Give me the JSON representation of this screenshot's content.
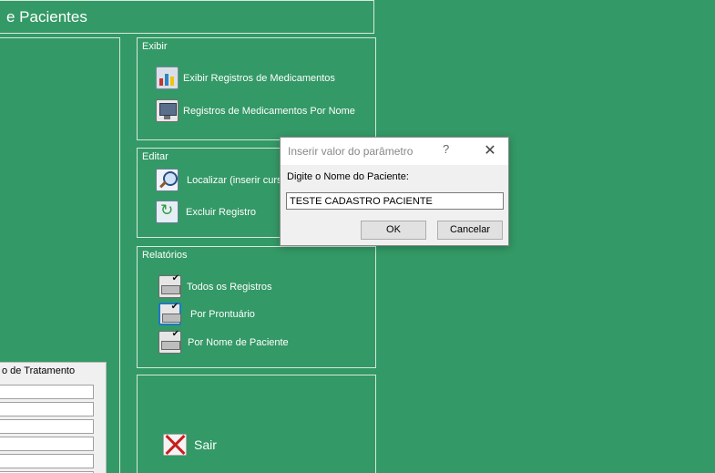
{
  "form": {
    "title": "e Pacientes"
  },
  "groups": {
    "exibir": {
      "label": "Exibir",
      "items": [
        {
          "label": "Exibir Registros de Medicamentos",
          "icon": "chart-icon"
        },
        {
          "label": "Registros de Medicamentos Por Nome",
          "icon": "monitor-icon"
        }
      ]
    },
    "editar": {
      "label": "Editar",
      "items": [
        {
          "label": "Localizar (inserir curso",
          "icon": "search-icon"
        },
        {
          "label": "Excluir Registro",
          "icon": "refresh-icon"
        }
      ]
    },
    "relatorios": {
      "label": "Relatórios",
      "items": [
        {
          "label": "Todos os Registros",
          "icon": "printer-icon"
        },
        {
          "label": "Por Prontuário",
          "icon": "printer-icon"
        },
        {
          "label": "Por Nome de Paciente",
          "icon": "printer-icon"
        }
      ]
    },
    "sair": {
      "label": "Sair",
      "icon": "exit-icon"
    }
  },
  "subform": {
    "header": "o de Tratamento"
  },
  "dialog": {
    "title": "Inserir valor do parâmetro",
    "help": "?",
    "close": "✕",
    "prompt": "Digite o Nome do Paciente:",
    "value": "TESTE CADASTRO PACIENTE",
    "ok_label": "OK",
    "cancel_label": "Cancelar"
  },
  "colors": {
    "background": "#339966",
    "frame": "#d8e8dc",
    "dialog_bg": "#f0f0f0"
  }
}
